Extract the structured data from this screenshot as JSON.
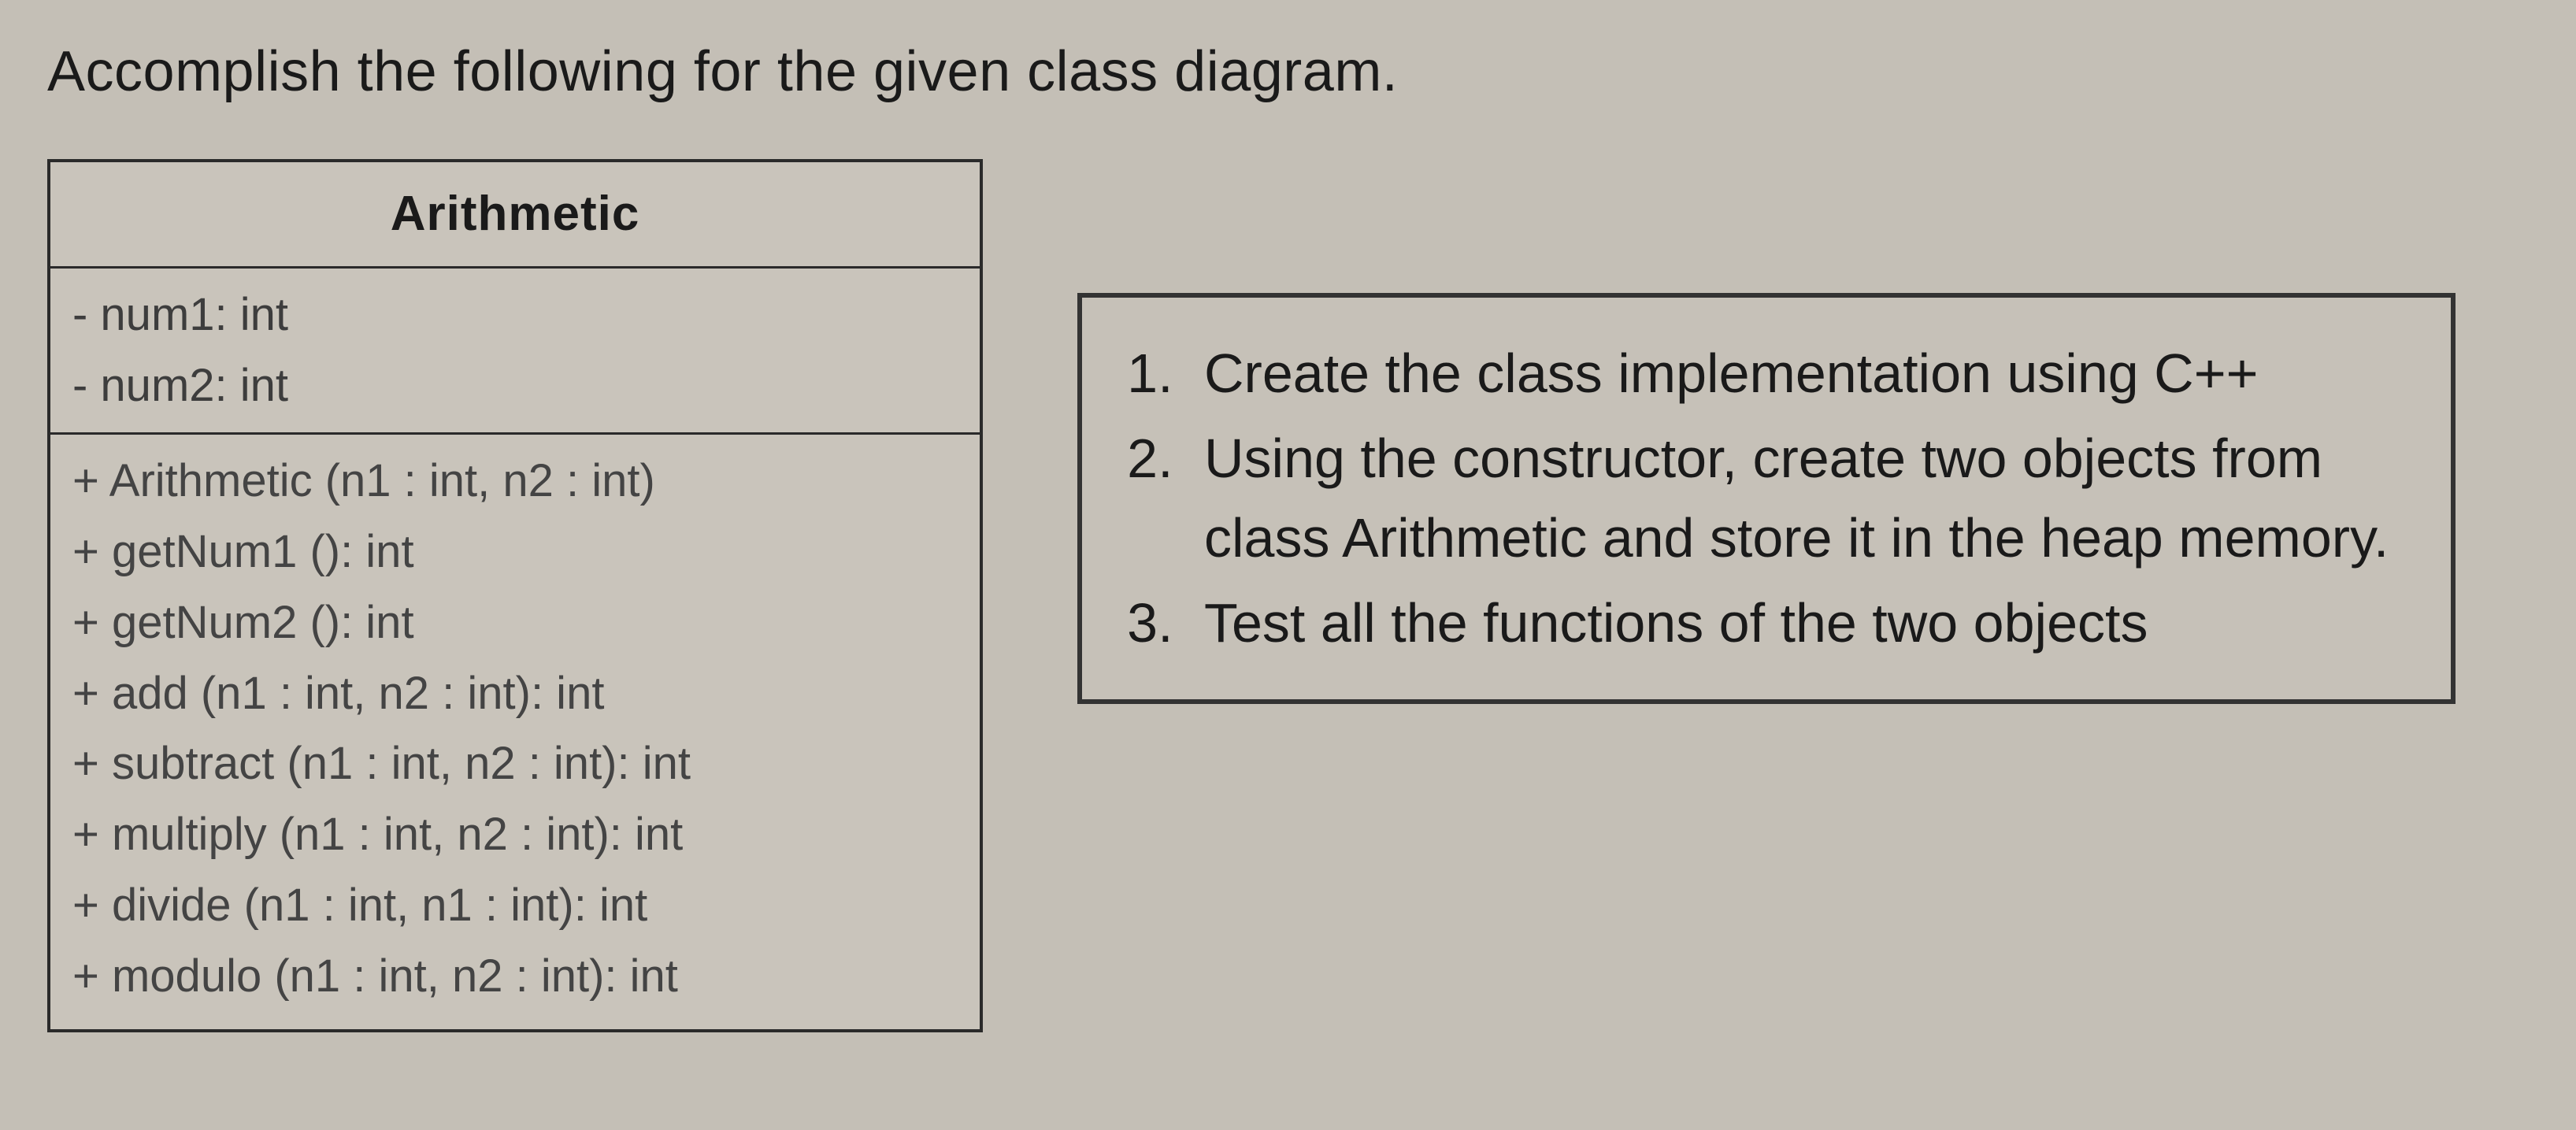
{
  "instruction": "Accomplish the following for the given class diagram.",
  "uml": {
    "class_name": "Arithmetic",
    "attributes": [
      "- num1: int",
      "- num2: int"
    ],
    "operations": [
      "+ Arithmetic (n1 : int, n2 : int)",
      "+ getNum1 (): int",
      "+ getNum2 (): int",
      "+ add (n1 : int, n2 : int): int",
      "+ subtract (n1 : int, n2 : int): int",
      "+ multiply (n1 : int, n2 : int): int",
      "+ divide (n1 : int, n1 : int): int",
      "+ modulo (n1 : int, n2 : int): int"
    ]
  },
  "tasks": [
    "Create the class implementation using C++",
    "Using the constructor, create two objects from class Arithmetic and store it in the heap memory.",
    "Test all the functions of the two objects"
  ]
}
